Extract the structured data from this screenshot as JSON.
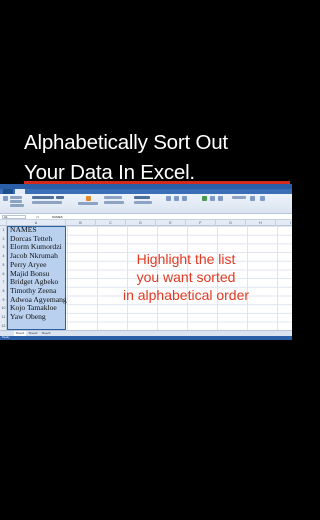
{
  "video_caption": {
    "line1": "Alphabetically Sort Out",
    "line2": "Your Data In Excel."
  },
  "excel": {
    "namebox": "A1",
    "formula_content": "NAMES",
    "columns": [
      "A",
      "B",
      "C",
      "D",
      "E",
      "F",
      "G",
      "H",
      "I",
      "J"
    ],
    "rows": [
      "1",
      "2",
      "3",
      "4",
      "5",
      "6",
      "7",
      "8",
      "9",
      "10",
      "11",
      "12"
    ],
    "cells": [
      "NAMES",
      "Dorcas Tetteh",
      "Elorm Kumordzi",
      "Jacob Nkrumah",
      "Perry Aryee",
      "Majid Bonsu",
      "Bridget Agbeko",
      "Timothy Zeena",
      "Adwoa Agyemang",
      "Kojo Tamakloe",
      "Yaw Obeng"
    ],
    "sheet_tabs": [
      "Sheet1",
      "Sheet2",
      "Sheet3"
    ],
    "status": "Ready"
  },
  "callout": {
    "line1": "Highlight the list",
    "line2": "you want sorted",
    "line3": "in alphabetical order"
  },
  "colors": {
    "caption_rule": "#d42a1c",
    "callout_text": "#e03a22",
    "selection_fill": "#b9d1ee",
    "excel_blue": "#2a5fa8"
  }
}
